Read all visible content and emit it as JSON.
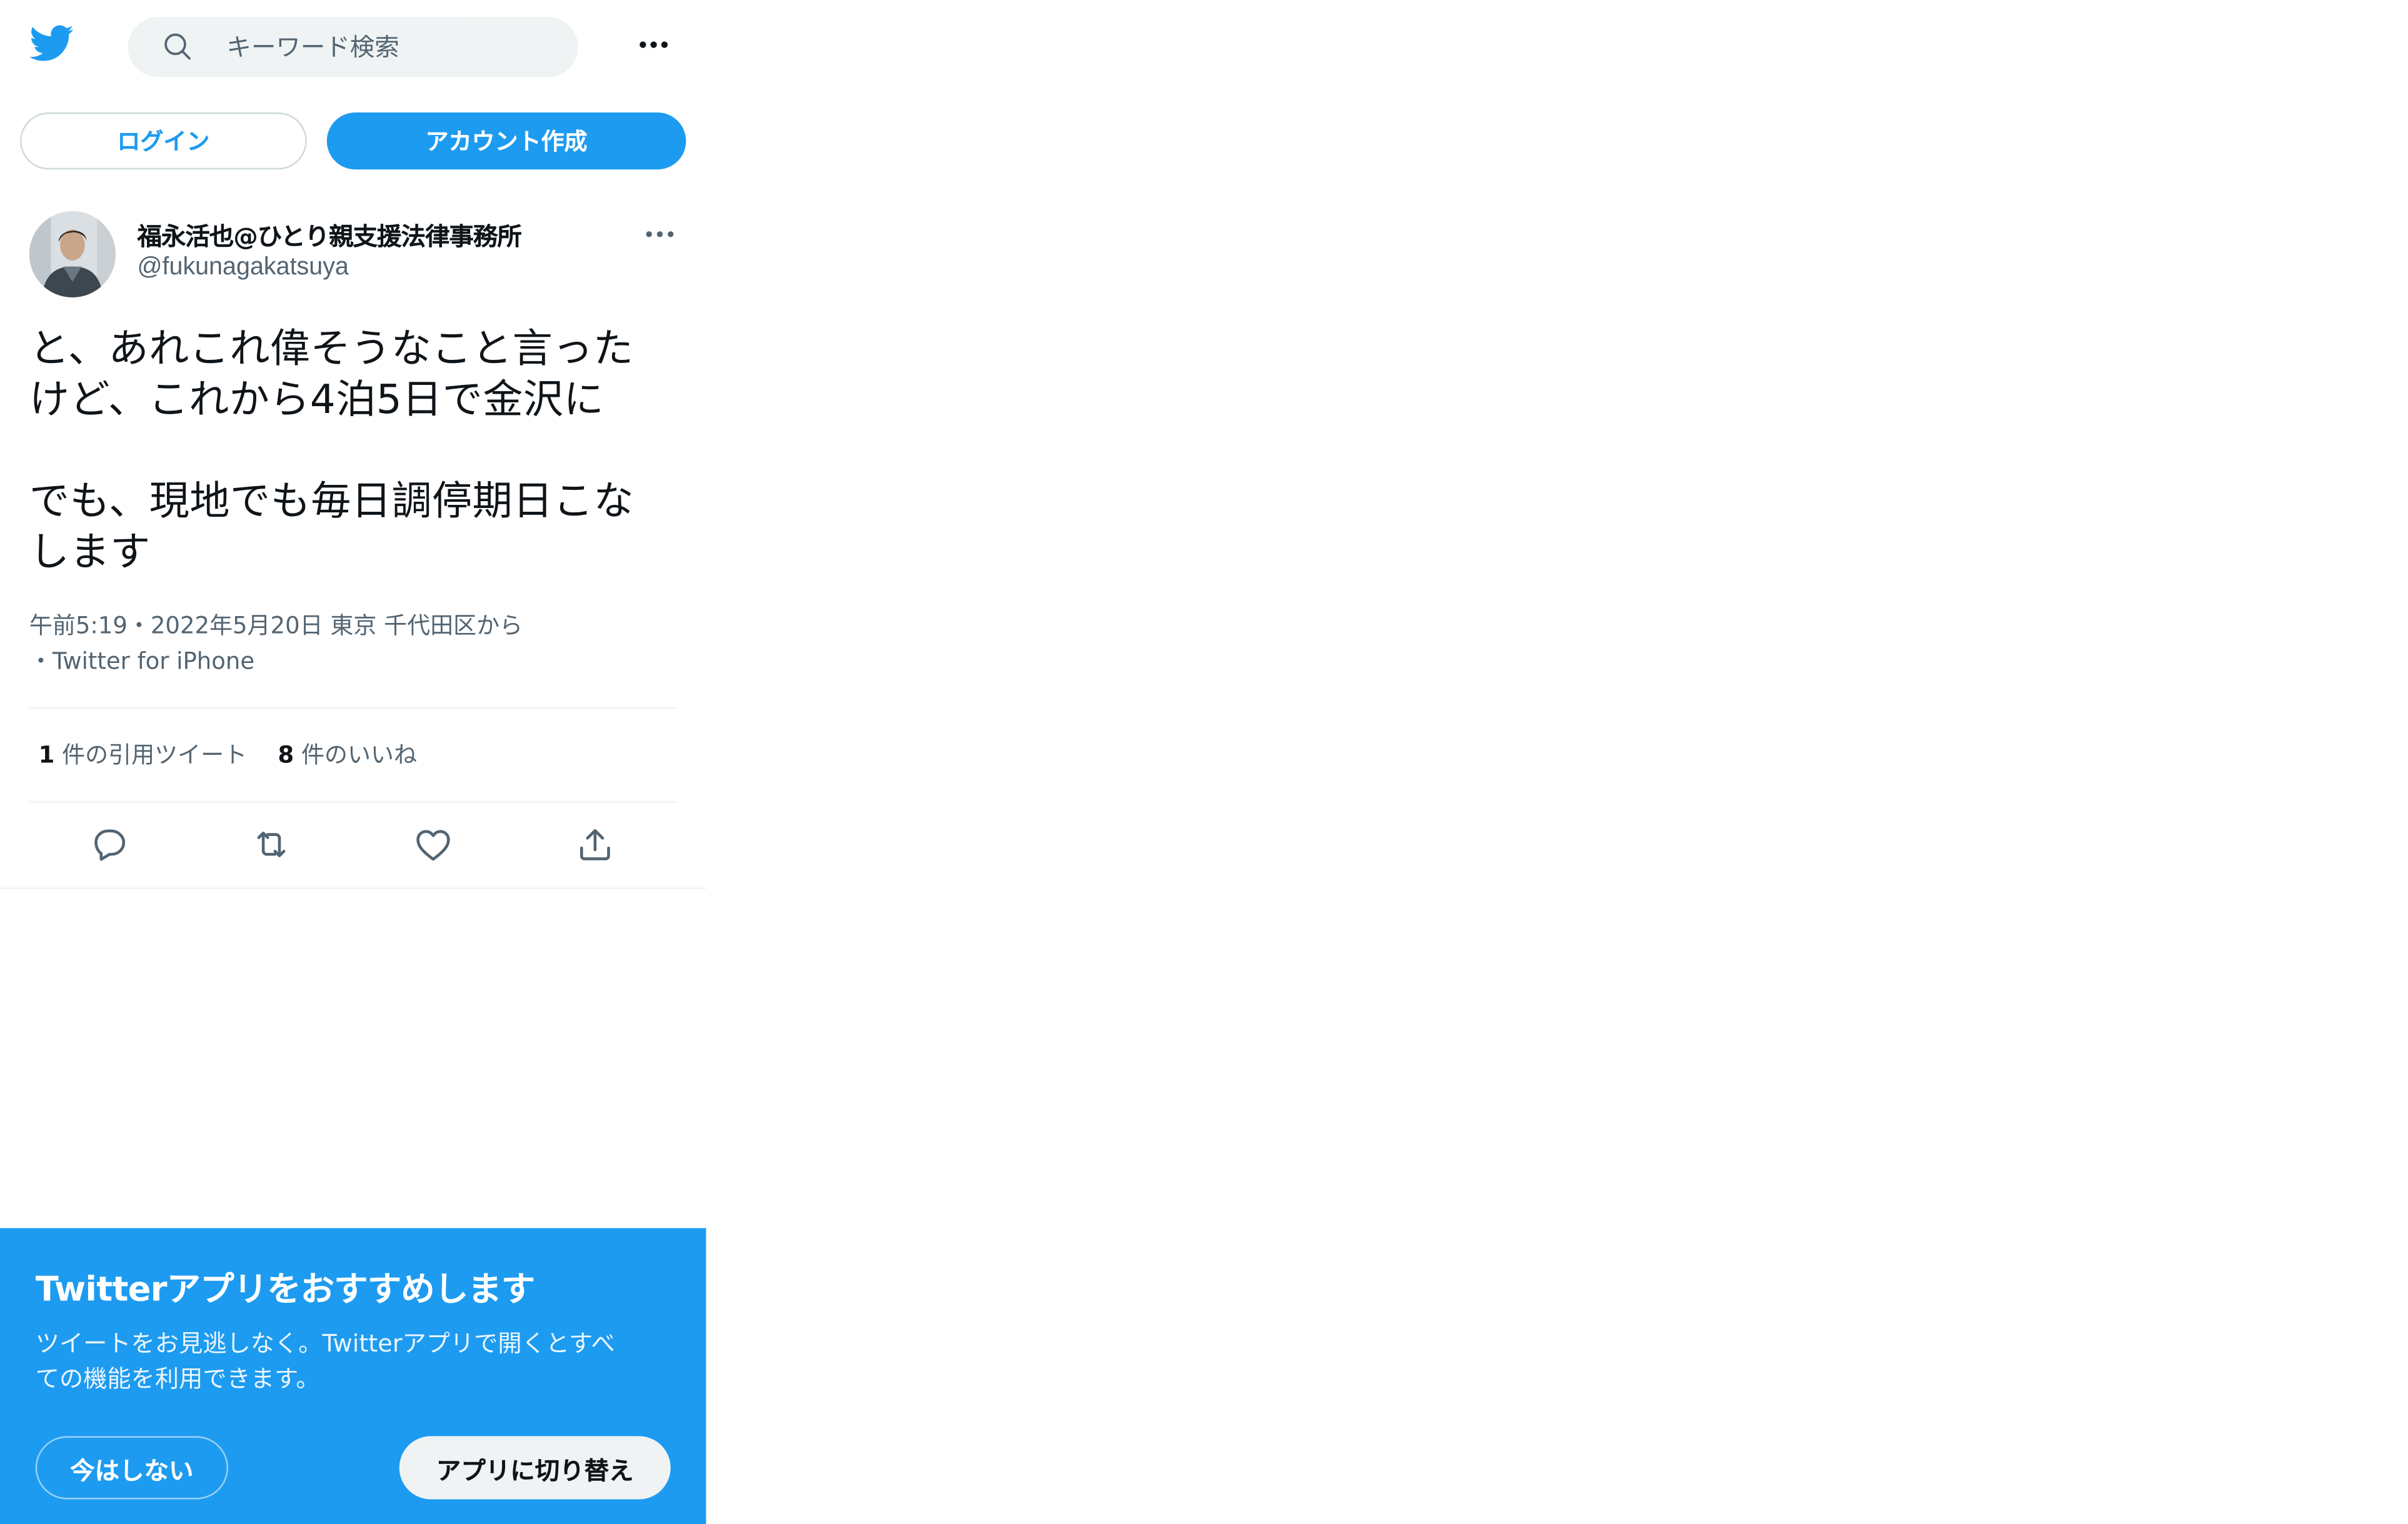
{
  "header": {
    "logo_icon": "twitter-bird-icon",
    "search_placeholder": "キーワード検索",
    "more_icon": "more-horizontal-icon"
  },
  "auth": {
    "login_label": "ログイン",
    "signup_label": "アカウント作成"
  },
  "tweet": {
    "display_name": "福永活也@ひとり親支援法律事務所",
    "handle": "@fukunagakatsuya",
    "text_lines": [
      "と、あれこれ偉そうなこと言った",
      "けど、これから4泊5日で金沢に",
      "",
      "でも、現地でも毎日調停期日こな",
      "します"
    ],
    "meta_line1": "午前5:19・2022年5月20日 東京 千代田区から",
    "meta_line2": "・Twitter for iPhone",
    "quote_count": "1",
    "quote_label": "件の引用ツイート",
    "like_count": "8",
    "like_label": "件のいいね"
  },
  "banner": {
    "title": "Twitterアプリをおすすめします",
    "desc_line1": "ツイートをお見逃しなく。Twitterアプリで開くとすべ",
    "desc_line2": "ての機能を利用できます。",
    "not_now_label": "今はしない",
    "switch_label": "アプリに切り替え"
  },
  "colors": {
    "brand_blue": "#1d9bf0",
    "text_primary": "#0f1419",
    "text_secondary": "#536471"
  }
}
